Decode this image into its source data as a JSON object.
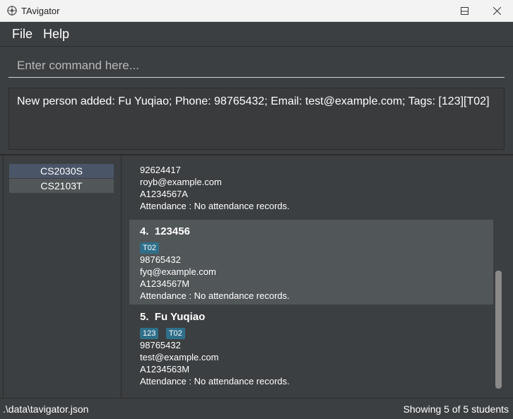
{
  "window": {
    "title": "TAvigator"
  },
  "menu": {
    "items": [
      "File",
      "Help"
    ]
  },
  "command": {
    "placeholder": "Enter command here..."
  },
  "result": {
    "text": "New person added: Fu Yuqiao; Phone: 98765432; Email: test@example.com; Tags: [123][T02]"
  },
  "courses": [
    "CS2030S",
    "CS2103T"
  ],
  "persons": [
    {
      "index": "",
      "name": "",
      "tags": [],
      "phone": "92624417",
      "email": "royb@example.com",
      "id": "A1234567A",
      "attendance": "Attendance : No attendance records."
    },
    {
      "index": "4.",
      "name": "123456",
      "tags": [
        "T02"
      ],
      "phone": "98765432",
      "email": "fyq@example.com",
      "id": "A1234567M",
      "attendance": "Attendance : No attendance records."
    },
    {
      "index": "5.",
      "name": "Fu Yuqiao",
      "tags": [
        "123",
        "T02"
      ],
      "phone": "98765432",
      "email": "test@example.com",
      "id": "A1234563M",
      "attendance": "Attendance : No attendance records."
    }
  ],
  "status": {
    "path": ".\\data\\tavigator.json",
    "count": "Showing 5 of 5 students"
  },
  "colors": {
    "background": "#3c3f41",
    "tag": "#2f6f8a",
    "selected_card": "#515658"
  }
}
